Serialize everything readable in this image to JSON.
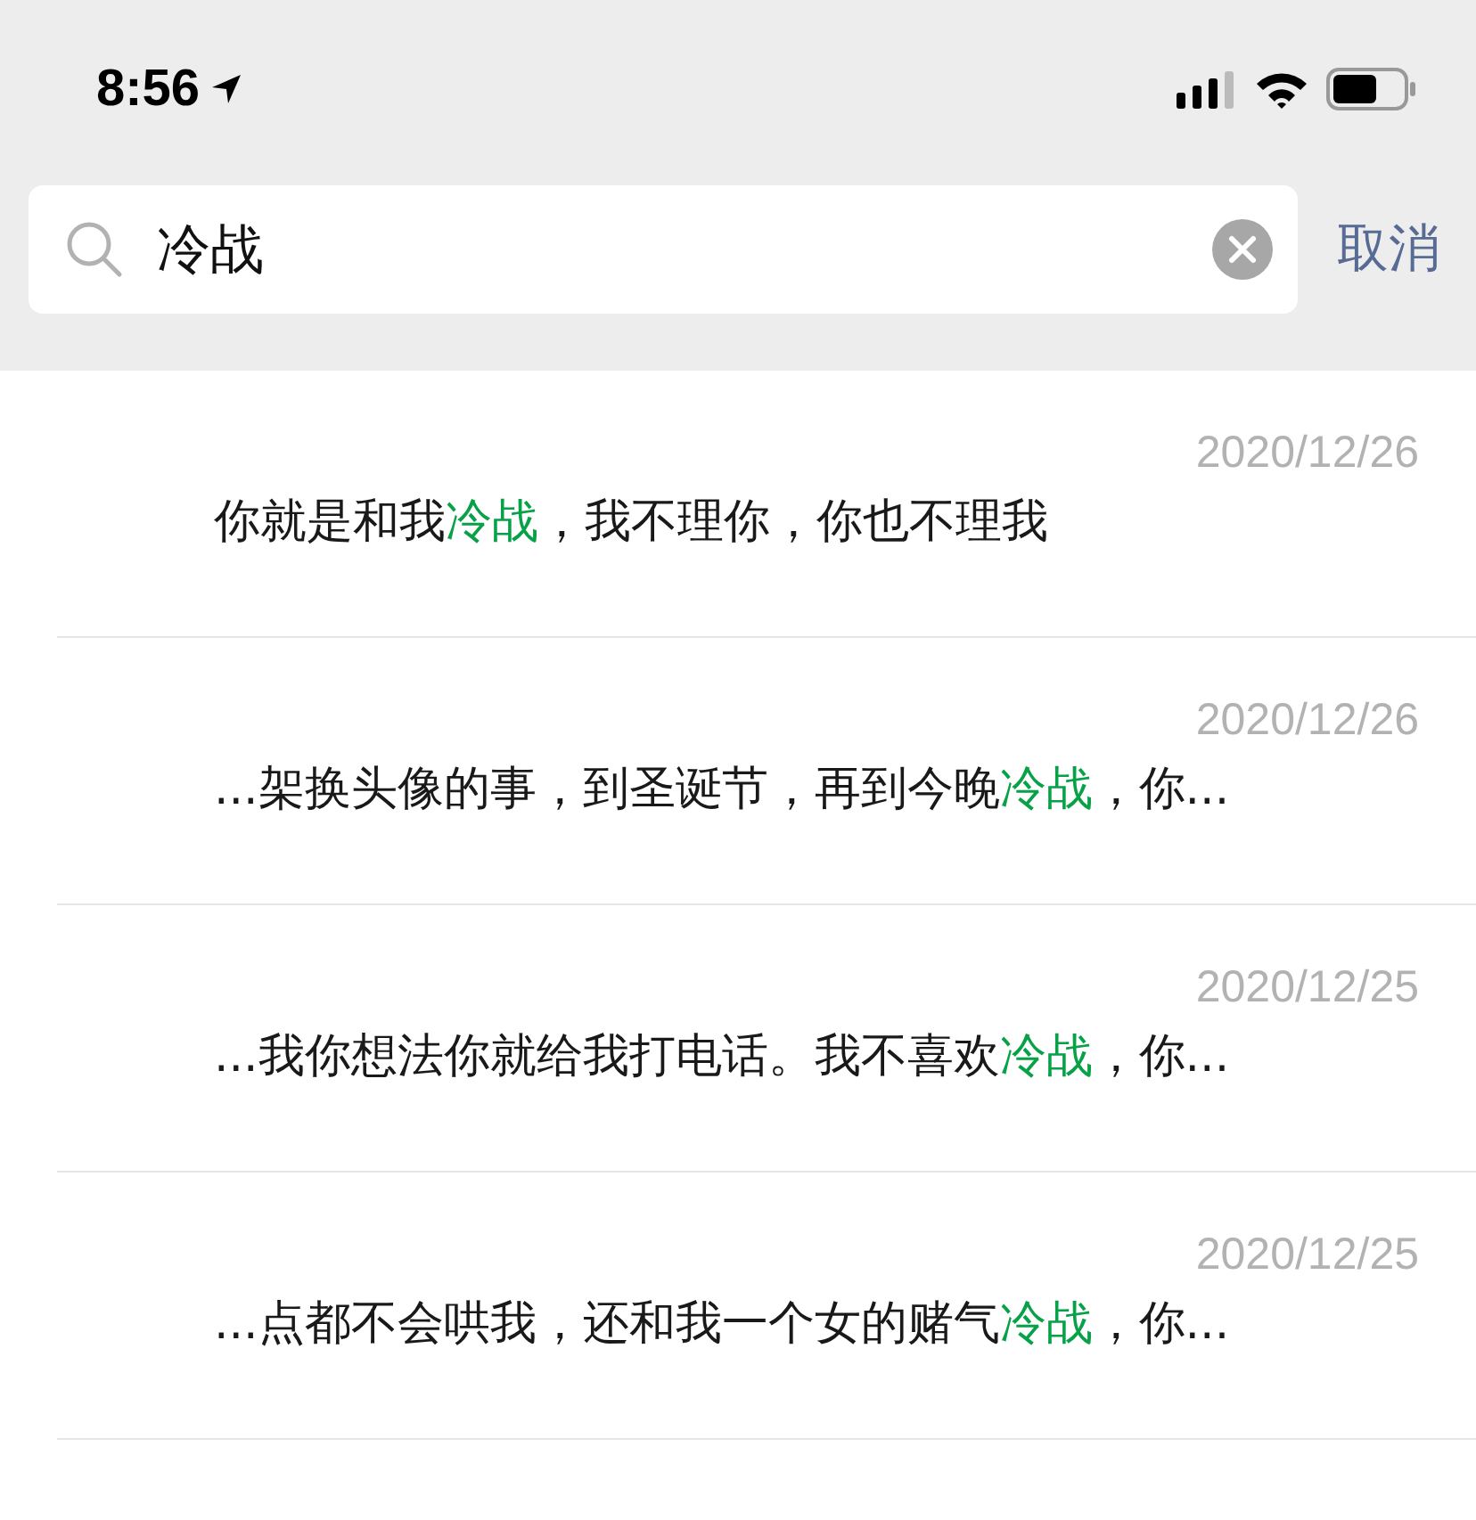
{
  "status_bar": {
    "time": "8:56"
  },
  "search": {
    "value": "冷战",
    "cancel": "取消"
  },
  "results": [
    {
      "date": "2020/12/26",
      "message": [
        {
          "text": "你就是和我",
          "highlight": false
        },
        {
          "text": "冷战",
          "highlight": true
        },
        {
          "text": "，我不理你，你也不理我",
          "highlight": false
        }
      ]
    },
    {
      "date": "2020/12/26",
      "message": [
        {
          "text": "...架换头像的事，到圣诞节，再到今晚",
          "highlight": false
        },
        {
          "text": "冷战",
          "highlight": true
        },
        {
          "text": "，你...",
          "highlight": false
        }
      ]
    },
    {
      "date": "2020/12/25",
      "message": [
        {
          "text": "...我你想法你就给我打电话。我不喜欢",
          "highlight": false
        },
        {
          "text": "冷战",
          "highlight": true
        },
        {
          "text": "，你...",
          "highlight": false
        }
      ]
    },
    {
      "date": "2020/12/25",
      "message": [
        {
          "text": "...点都不会哄我，还和我一个女的赌气",
          "highlight": false
        },
        {
          "text": "冷战",
          "highlight": true
        },
        {
          "text": "，你...",
          "highlight": false
        }
      ]
    }
  ]
}
